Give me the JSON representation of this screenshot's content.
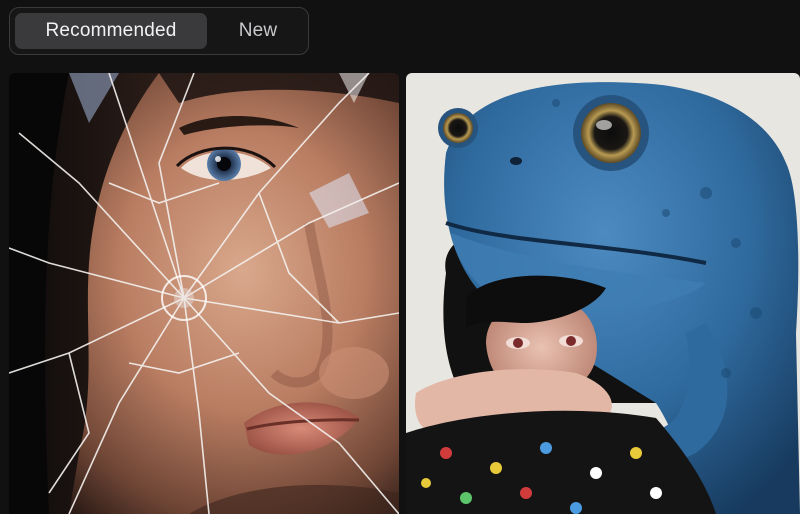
{
  "tabs": {
    "recommended_label": "Recommended",
    "new_label": "New"
  },
  "feed": {
    "items": [
      {
        "subject": "woman-face-broken-glass"
      },
      {
        "subject": "giant-blue-frog-on-girl"
      }
    ]
  },
  "colors": {
    "background": "#111112",
    "tab_active_bg": "#3a3a3d",
    "tab_border": "#3a3a3d",
    "frog_blue": "#2f6a9e",
    "frog_eye_gold": "#b89a52",
    "right_card_bg": "#e8e6e1"
  }
}
